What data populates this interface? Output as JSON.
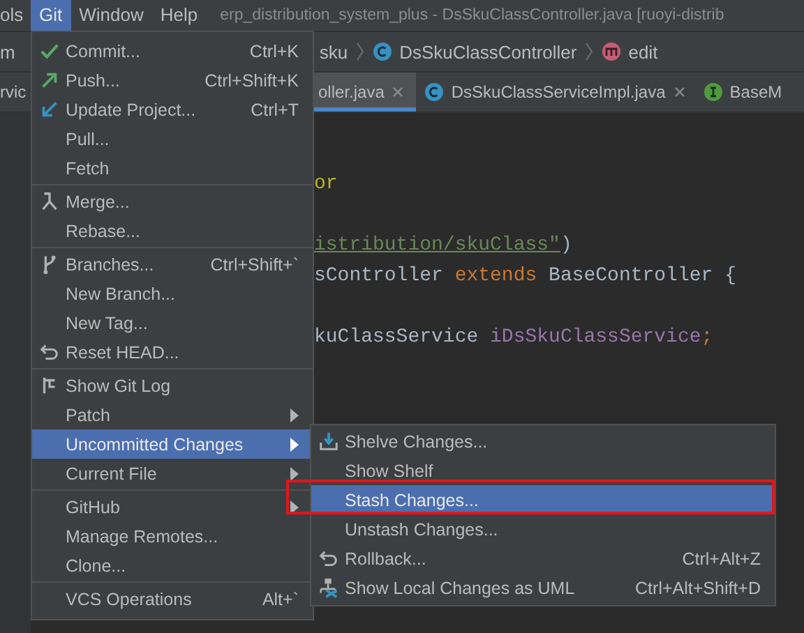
{
  "menu_bar": {
    "items": [
      {
        "label": "ols",
        "selected": false
      },
      {
        "label": "Git",
        "selected": true
      },
      {
        "label": "Window",
        "selected": false
      },
      {
        "label": "Help",
        "selected": false
      }
    ],
    "title": "erp_distribution_system_plus - DsSkuClassController.java [ruoyi-distrib"
  },
  "breadcrumbs": [
    {
      "label": "m",
      "kind": "plain"
    },
    {
      "label": "sku",
      "kind": "plain"
    },
    {
      "label": "DsSkuClassController",
      "kind": "class"
    },
    {
      "label": "edit",
      "kind": "method"
    }
  ],
  "tabs": [
    {
      "label": "rvic",
      "kind": "plain",
      "selected": false,
      "closable": false
    },
    {
      "label": "oller.java",
      "kind": "plain",
      "selected": true,
      "closable": true
    },
    {
      "label": "DsSkuClassServiceImpl.java",
      "kind": "class",
      "selected": false,
      "closable": true
    },
    {
      "label": "BaseM",
      "kind": "interface",
      "selected": false,
      "closable": false
    }
  ],
  "code_lines": [
    [
      {
        "text": "or",
        "kind": "annotation"
      }
    ],
    [
      {
        "text": "istribution/skuClass\"",
        "kind": "string"
      },
      {
        "text": ")",
        "kind": "plain"
      }
    ],
    [
      {
        "text": "sController ",
        "kind": "plain"
      },
      {
        "text": "extends",
        "kind": "keyword"
      },
      {
        "text": " BaseController {",
        "kind": "plain"
      }
    ],
    [
      {
        "text": "kuClassService ",
        "kind": "plain"
      },
      {
        "text": "iDsSkuClassService",
        "kind": "field"
      },
      {
        "text": ";",
        "kind": "keyword"
      }
    ]
  ],
  "git_menu": [
    {
      "kind": "check",
      "label": "Commit...",
      "shortcut": "Ctrl+K",
      "submenu": false,
      "selected": false
    },
    {
      "kind": "push",
      "label": "Push...",
      "shortcut": "Ctrl+Shift+K",
      "submenu": false,
      "selected": false
    },
    {
      "kind": "update",
      "label": "Update Project...",
      "shortcut": "Ctrl+T",
      "submenu": false,
      "selected": false
    },
    {
      "kind": "plain",
      "label": "Pull...",
      "submenu": false,
      "selected": false
    },
    {
      "kind": "plain",
      "label": "Fetch",
      "submenu": false,
      "selected": false
    },
    {
      "kind": "separator"
    },
    {
      "kind": "merge",
      "label": "Merge...",
      "submenu": false,
      "selected": false
    },
    {
      "kind": "plain",
      "label": "Rebase...",
      "submenu": false,
      "selected": false
    },
    {
      "kind": "separator"
    },
    {
      "kind": "branch",
      "label": "Branches...",
      "shortcut": "Ctrl+Shift+`",
      "submenu": false,
      "selected": false
    },
    {
      "kind": "plain",
      "label": "New Branch...",
      "submenu": false,
      "selected": false
    },
    {
      "kind": "plain",
      "label": "New Tag...",
      "submenu": false,
      "selected": false
    },
    {
      "kind": "undo",
      "label": "Reset HEAD...",
      "submenu": false,
      "selected": false
    },
    {
      "kind": "separator"
    },
    {
      "kind": "log",
      "label": "Show Git Log",
      "submenu": false,
      "selected": false
    },
    {
      "kind": "plain",
      "label": "Patch",
      "submenu": true,
      "selected": false
    },
    {
      "kind": "plain",
      "label": "Uncommitted Changes",
      "submenu": true,
      "selected": true
    },
    {
      "kind": "plain",
      "label": "Current File",
      "submenu": true,
      "selected": false
    },
    {
      "kind": "separator"
    },
    {
      "kind": "plain",
      "label": "GitHub",
      "submenu": true,
      "selected": false
    },
    {
      "kind": "plain",
      "label": "Manage Remotes...",
      "submenu": false,
      "selected": false
    },
    {
      "kind": "plain",
      "label": "Clone...",
      "submenu": false,
      "selected": false
    },
    {
      "kind": "separator"
    },
    {
      "kind": "plain",
      "label": "VCS Operations",
      "shortcut": "Alt+`",
      "submenu": false,
      "selected": false
    }
  ],
  "submenu": [
    {
      "kind": "shelve",
      "label": "Shelve Changes...",
      "selected": false,
      "outlined": false
    },
    {
      "kind": "plain",
      "label": "Show Shelf",
      "selected": false,
      "outlined": false
    },
    {
      "kind": "plain",
      "label": "Stash Changes...",
      "selected": true,
      "outlined": true
    },
    {
      "kind": "plain",
      "label": "Unstash Changes...",
      "selected": false,
      "outlined": false
    },
    {
      "kind": "undo",
      "label": "Rollback...",
      "shortcut": "Ctrl+Alt+Z",
      "selected": false,
      "outlined": false
    },
    {
      "kind": "uml",
      "label": "Show Local Changes as UML",
      "shortcut": "Ctrl+Alt+Shift+D",
      "selected": false,
      "outlined": false
    }
  ]
}
